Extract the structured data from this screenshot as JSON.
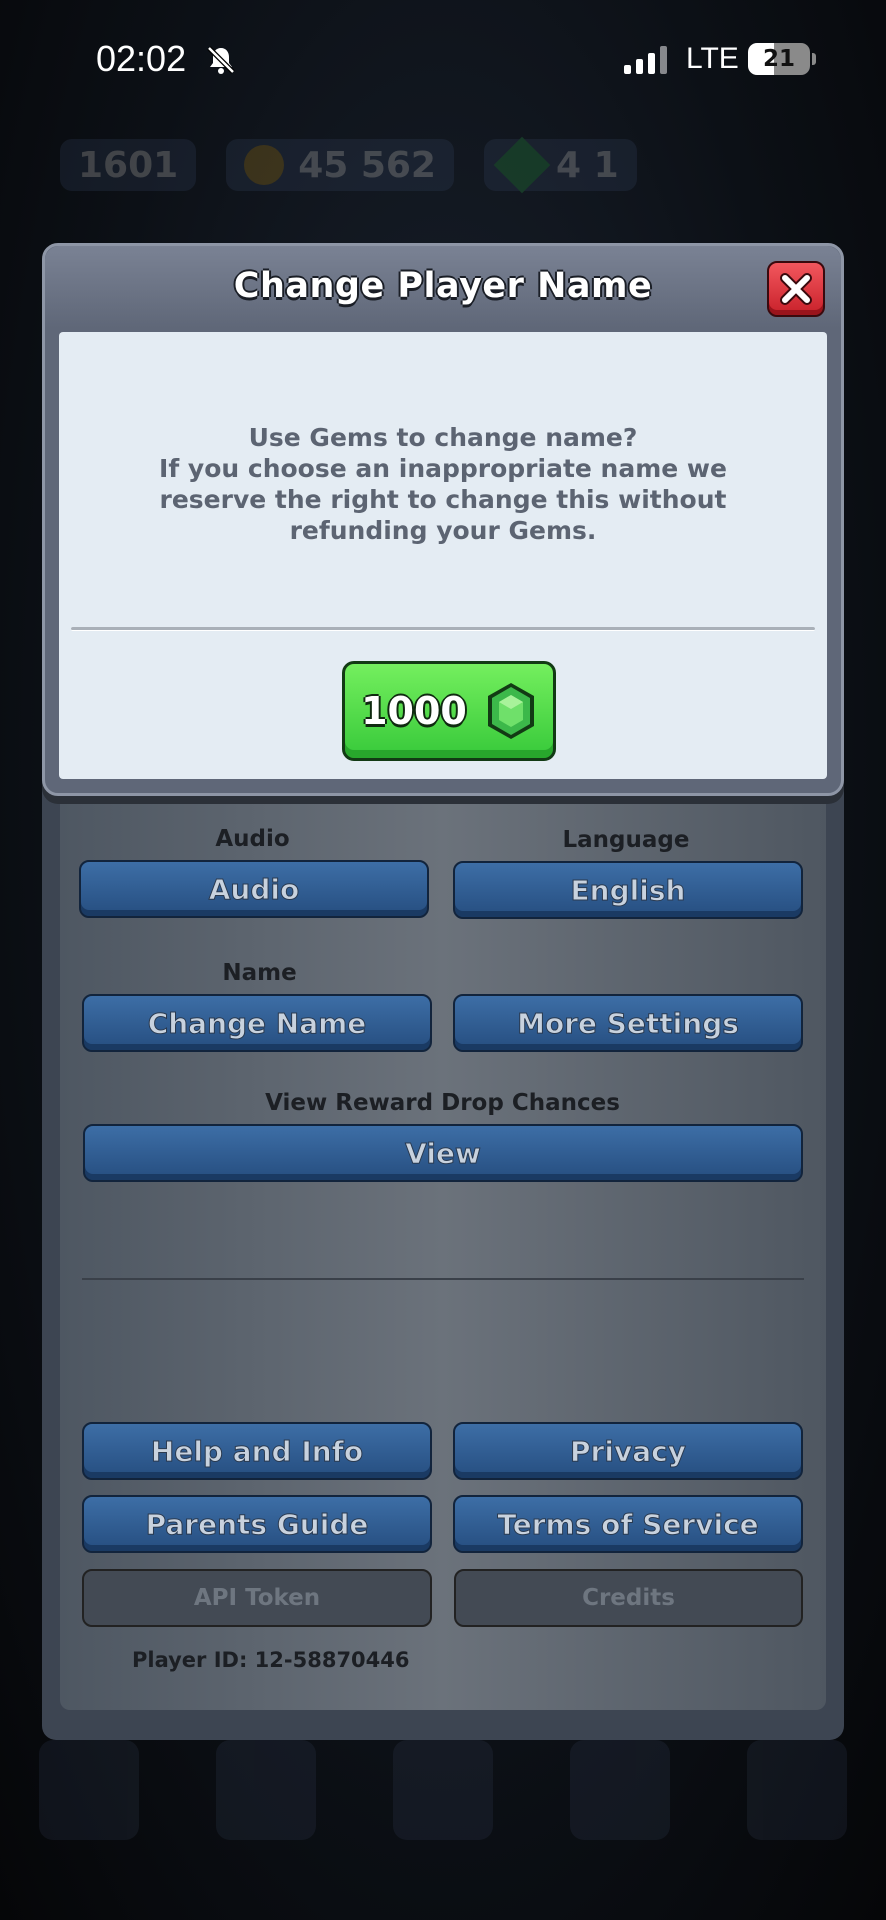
{
  "status_bar": {
    "time": "02:02",
    "network": "LTE",
    "battery": "21"
  },
  "background_hud": {
    "trophies": "1601",
    "gold": "45 562",
    "gems": "4 1"
  },
  "settings": {
    "audio_label": "Audio",
    "audio_button": "Audio",
    "language_label": "Language",
    "language_button": "English",
    "name_label": "Name",
    "change_name_button": "Change Name",
    "more_settings_button": "More Settings",
    "reward_label": "View Reward Drop Chances",
    "view_button": "View",
    "help_button": "Help and Info",
    "privacy_button": "Privacy",
    "parents_button": "Parents Guide",
    "terms_button": "Terms of Service",
    "api_button": "API Token",
    "credits_button": "Credits",
    "player_id": "Player ID: 12-58870446"
  },
  "dialog": {
    "title": "Change Player Name",
    "message_lines": [
      "Use Gems to change name?",
      "If you choose an inappropriate name we",
      "reserve the right to change this without",
      "refunding your Gems."
    ],
    "gem_cost": "1000",
    "colors": {
      "confirm_green": "#4fd846",
      "close_red": "#e2383f",
      "gem_green": "#3cb84a"
    }
  }
}
